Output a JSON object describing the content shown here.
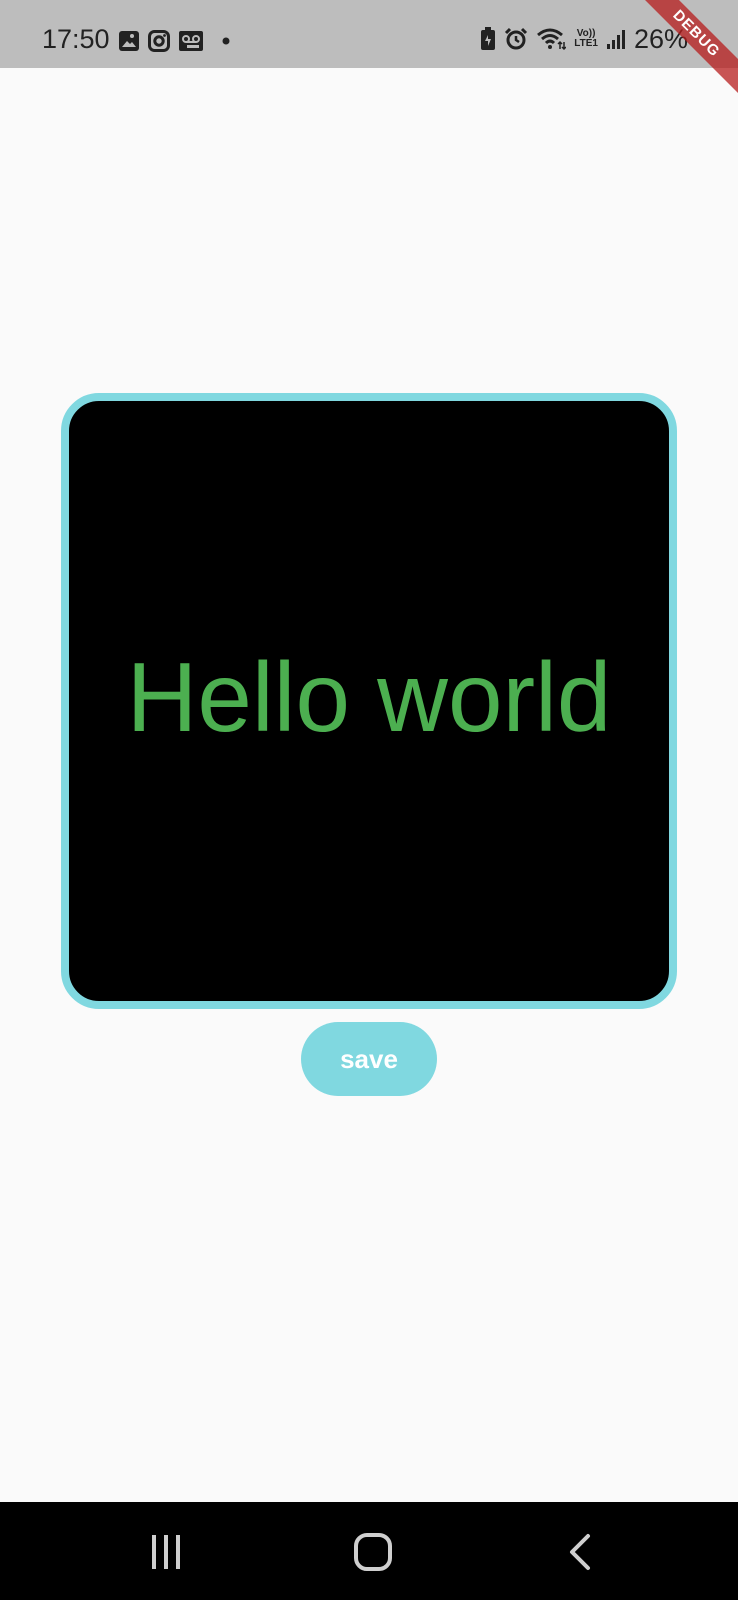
{
  "status_bar": {
    "time": "17:50",
    "battery": "26%",
    "network": "LTE1",
    "icons_left": [
      "gallery-icon",
      "instagram-icon",
      "voicemail-icon",
      "dot-icon"
    ],
    "icons_right": [
      "battery-saver-icon",
      "alarm-icon",
      "wifi-icon",
      "volte-icon",
      "signal-icon"
    ]
  },
  "debug_banner": {
    "label": "DEBUG"
  },
  "card": {
    "text": "Hello world",
    "text_color": "#4caf50",
    "background": "#000000",
    "border_color": "#80d8e0"
  },
  "save_button": {
    "label": "save",
    "color": "#80d8e0"
  },
  "nav_bar": {
    "buttons": [
      "recent-apps-icon",
      "home-icon",
      "back-icon"
    ]
  }
}
